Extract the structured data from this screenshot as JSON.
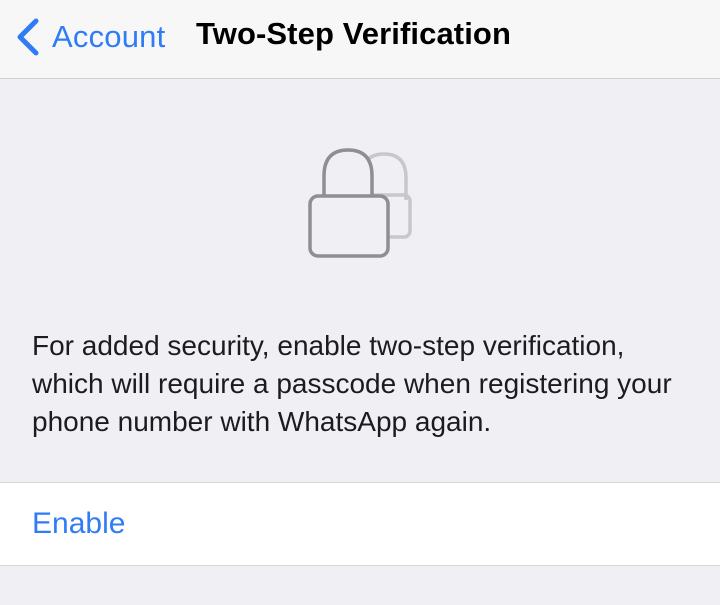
{
  "nav": {
    "back_label": "Account",
    "title": "Two-Step Verification"
  },
  "icon": "lock-stack-icon",
  "description": "For added security, enable two-step verification, which will require a passcode when registering your phone number with WhatsApp again.",
  "actions": {
    "enable_label": "Enable"
  },
  "colors": {
    "accent": "#2f7cf6",
    "background": "#efeff4",
    "nav_background": "#f7f7f7",
    "cell_background": "#ffffff",
    "icon_stroke": "#8e8e93"
  }
}
